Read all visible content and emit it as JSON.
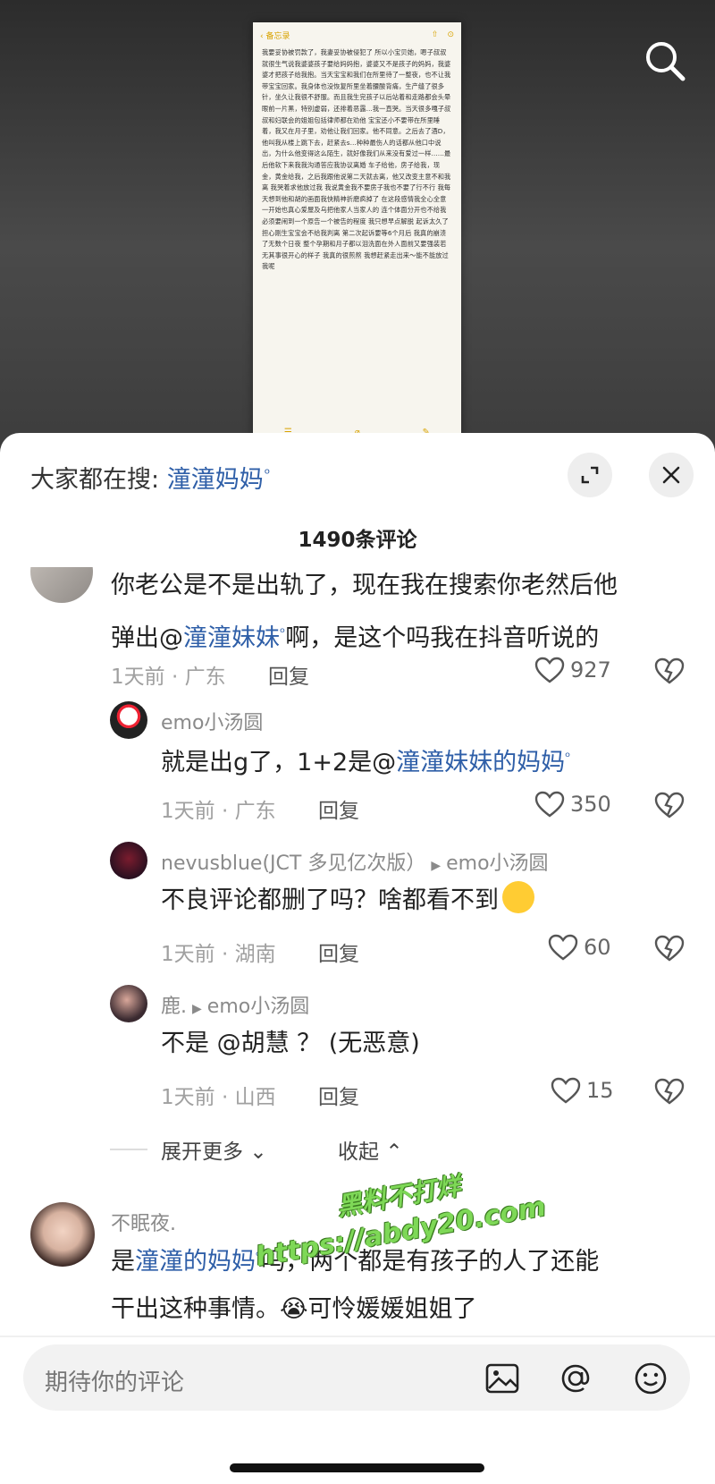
{
  "note": {
    "back_label": "备忘录",
    "body": "我要妥协被罚款了，我妻妥协被侵犯了 所以小宝贝她，嗯子叔叔就很生气说我婆婆孩子要给妈妈抱，婆婆又不是孩子的妈妈，我婆婆才把孩子给我抱。当天宝宝和我们在所里待了一整夜，也不让我带宝宝回家。我身体也没恢复所里坐着腰酸背痛，生产缝了很多针，坐久让我很不舒服。而且我生完孩子以后站着和走路都会头晕眼前一片黑，特别虚弱，还排着恶露…我一直哭。当天很多嘎子叔叔和妇联会的姐姐包括律师都在劝他 宝宝还小不要带在所里睡着，我又在月子里，劝他让我们回家。他不同意。之后去了酒D，他叫我从楼上跳下去，赶紧去s…种种最伤人的话都从他口中说出，为什么他变得这么陌生，就好像我们从来没有爱过一样……最后他软下来我我沟通答应我协议离婚 车子给他，房子给我，现金，黄金给我，之后我跟他说第二天就去离，他又改变主意不和我离 我哭着求他放过我 我说黄金我不要房子我也不要了行不行 我每天想到他和胡的画面我快精神折磨疯掉了 在这段感情我全心全意 一开始也真心爱屋及乌把他家人当家人的 连个体面分开也不给我 必须要闹到一个原告一个被告的程度 我只想早点解脱 起诉太久了 担心刚生宝宝会不给我判离 第二次起诉要等6个月后 我真的崩溃了无数个日夜 整个孕期和月子都以泪洗面在外人面前又要强装若无其事很开心的样子 我真的很煎熬 我想赶紧走出来～能不能放过我呢"
  },
  "header": {
    "search_prefix": "大家都在搜:",
    "search_keyword": "潼潼妈妈",
    "count_label": "1490条评论"
  },
  "comments": [
    {
      "text_before": "你老公是不是出轨了，现在我在搜索你老然后他",
      "line2_before": "弹出@",
      "line2_keyword": "潼潼妹妹",
      "line2_after": "啊，是这个吗我在抖音听说的",
      "meta": "1天前 · 广东",
      "reply": "回复",
      "likes": "927"
    },
    {
      "user": "emo小汤圆",
      "text_before": "就是出g了，1+2是@",
      "keyword": "潼潼妹妹的妈妈",
      "meta": "1天前 · 广东",
      "reply": "回复",
      "likes": "350"
    },
    {
      "user": "nevusblue(JCT 多见亿次版）",
      "reply_to": "emo小汤圆",
      "text": "不良评论都删了吗？啥都看不到",
      "meta": "1天前 · 湖南",
      "reply": "回复",
      "likes": "60"
    },
    {
      "user": "鹿.",
      "reply_to": "emo小汤圆",
      "text": "不是 @胡慧 ？ (无恶意)",
      "meta": "1天前 · 山西",
      "reply": "回复",
      "likes": "15"
    },
    {
      "user": "不眠夜.",
      "text_before": "是",
      "keyword": "潼潼的妈妈",
      "text_after": "吗，两个都是有孩子的人了还能",
      "line2": "干出这种事情。😭可怜媛媛姐姐了"
    }
  ],
  "collapse": {
    "expand_more": "展开更多",
    "collapse": "收起"
  },
  "watermark": {
    "line1": "黑料不打烊",
    "line2": "https://abdy20.com"
  },
  "input": {
    "placeholder": "期待你的评论"
  },
  "colors": {
    "keyword_blue": "#2f5fa8",
    "watermark_green": "#7ed857"
  },
  "icons": [
    "search-icon",
    "expand-icon",
    "close-icon",
    "heart-icon",
    "broken-heart-icon",
    "image-icon",
    "at-icon",
    "emoji-icon"
  ]
}
